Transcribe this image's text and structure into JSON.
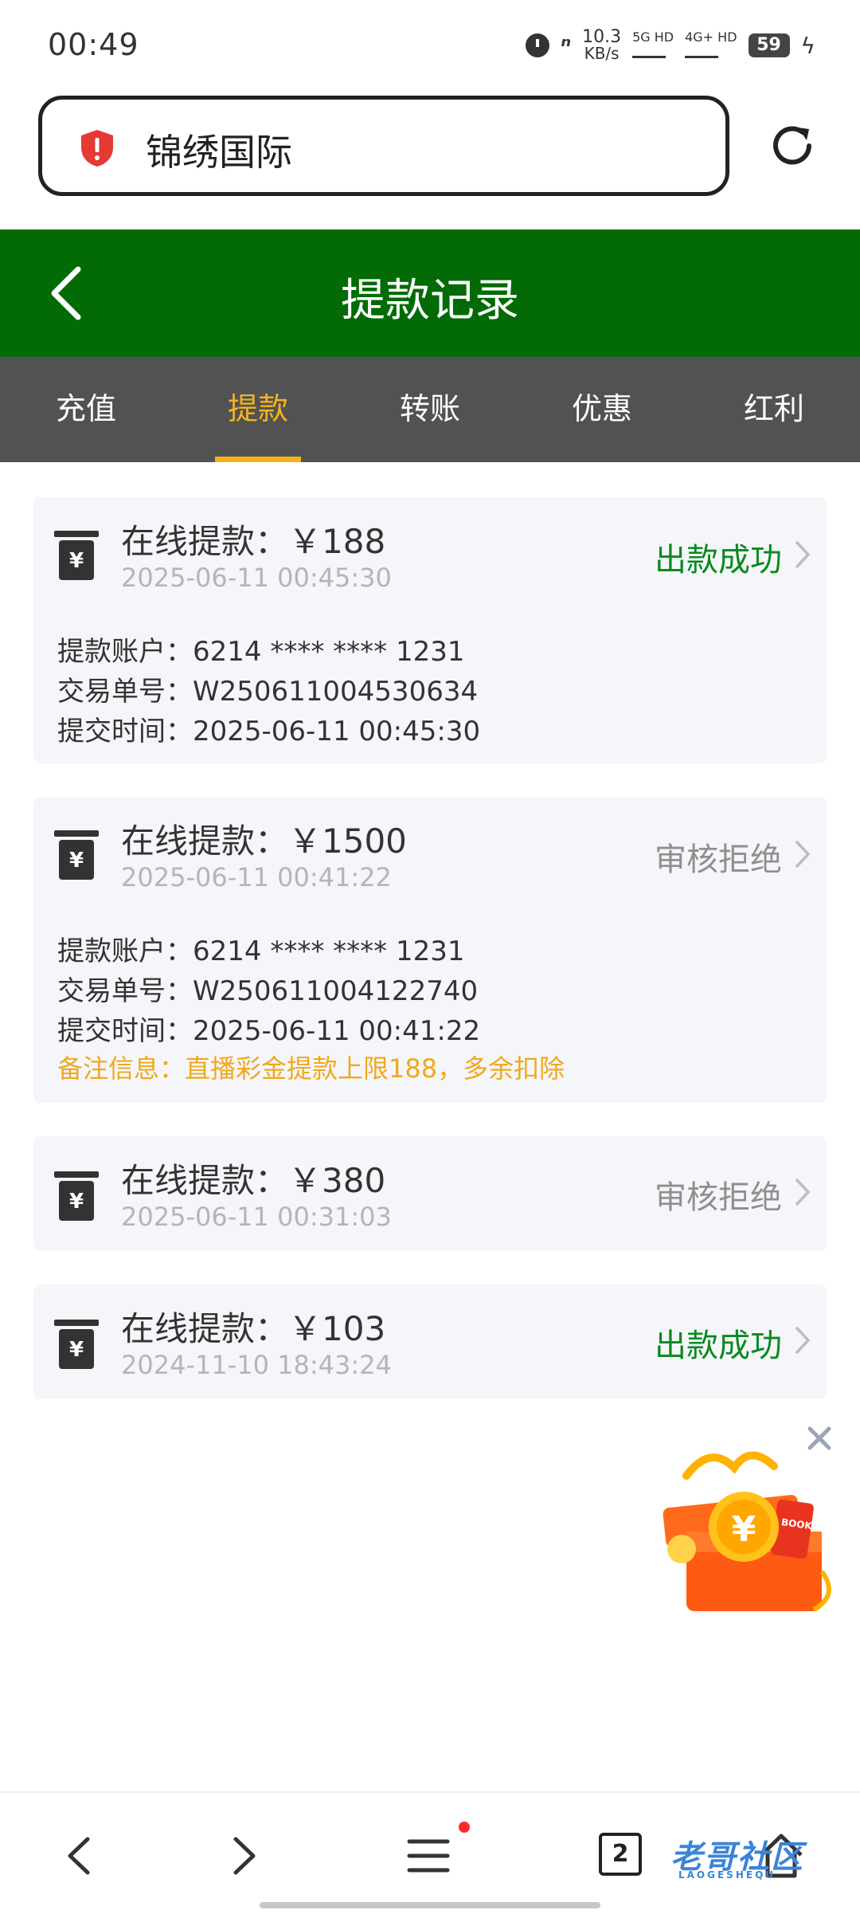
{
  "status_bar": {
    "time": "00:49",
    "net_speed": "10.3",
    "net_unit": "KB/s",
    "sig1": "5G HD",
    "sig2": "4G+ HD",
    "battery": "59"
  },
  "address_bar": {
    "site_name": "锦绣国际",
    "shield_color": "#e53935"
  },
  "header": {
    "title": "提款记录",
    "bg_color": "#026b05"
  },
  "tabs": [
    {
      "label": "充值",
      "active": false
    },
    {
      "label": "提款",
      "active": true
    },
    {
      "label": "转账",
      "active": false
    },
    {
      "label": "优惠",
      "active": false
    },
    {
      "label": "红利",
      "active": false
    }
  ],
  "records": [
    {
      "title": "在线提款：￥188",
      "date": "2025-06-11 00:45:30",
      "status": "出款成功",
      "status_type": "ok",
      "account": "提款账户：6214 **** **** 1231",
      "order_no": "交易单号：W250611004530634",
      "submit_time": "提交时间：2025-06-11 00:45:30"
    },
    {
      "title": "在线提款：￥1500",
      "date": "2025-06-11 00:41:22",
      "status": "审核拒绝",
      "status_type": "reject",
      "account": "提款账户：6214 **** **** 1231",
      "order_no": "交易单号：W250611004122740",
      "submit_time": "提交时间：2025-06-11 00:41:22",
      "note": "备注信息：直播彩金提款上限188，多余扣除"
    },
    {
      "title": "在线提款：￥380",
      "date": "2025-06-11 00:31:03",
      "status": "审核拒绝",
      "status_type": "reject"
    },
    {
      "title": "在线提款：￥103",
      "date": "2024-11-10 18:43:24",
      "status": "出款成功",
      "status_type": "ok"
    }
  ],
  "promo": {
    "box_label": "BOOK"
  },
  "bottom_nav": {
    "tab_count": "2",
    "watermark": "老哥社区",
    "watermark_sub": "LAOGESHEQU"
  },
  "colors": {
    "accent": "#f5b21c",
    "success": "#0b8a1f",
    "reject": "#8f8f8f",
    "tabs_bg": "#525252"
  }
}
